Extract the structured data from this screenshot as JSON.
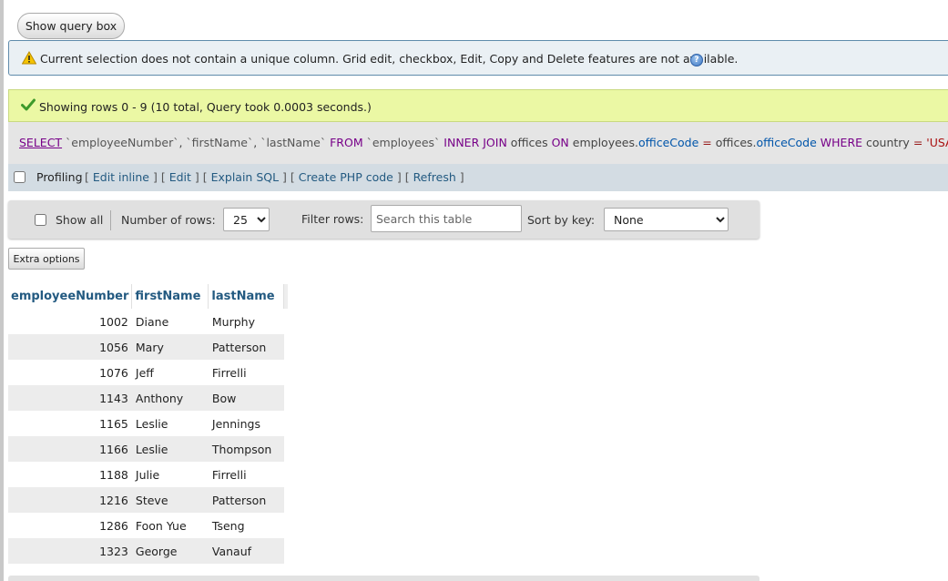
{
  "query_box": {
    "show_label": "Show query box"
  },
  "notice": {
    "text": "Current selection does not contain a unique column. Grid edit, checkbox, Edit, Copy and Delete features are not available.",
    "help_icon": "help-icon"
  },
  "success": {
    "text": "Showing rows 0 - 9 (10 total, Query took 0.0003 seconds.)"
  },
  "sql": {
    "select": "SELECT",
    "col1": "`employeeNumber`",
    "col2": "`firstName`",
    "col3": "`lastName`",
    "from": "FROM",
    "table": "`employees`",
    "join": "INNER JOIN",
    "join_table": "offices",
    "on": "ON",
    "left_tbl": "employees.",
    "left_col": "officeCode",
    "eq": "=",
    "right_tbl": "offices.",
    "right_col": "officeCode",
    "where": "WHERE",
    "where_col": "country",
    "where_val": "'USA'",
    "end": ";"
  },
  "profiling": {
    "label": "Profiling",
    "links": [
      "Edit inline",
      "Edit",
      "Explain SQL",
      "Create PHP code",
      "Refresh"
    ]
  },
  "navigation": {
    "show_all_label": "Show all",
    "rows_label": "Number of rows:",
    "rows_value": "25",
    "filter_label": "Filter rows:",
    "filter_placeholder": "Search this table",
    "sort_label": "Sort by key:",
    "sort_value": "None"
  },
  "extra_options_label": "Extra options",
  "table": {
    "headers": [
      "employeeNumber",
      "firstName",
      "lastName"
    ],
    "rows": [
      [
        "1002",
        "Diane",
        "Murphy"
      ],
      [
        "1056",
        "Mary",
        "Patterson"
      ],
      [
        "1076",
        "Jeff",
        "Firrelli"
      ],
      [
        "1143",
        "Anthony",
        "Bow"
      ],
      [
        "1165",
        "Leslie",
        "Jennings"
      ],
      [
        "1166",
        "Leslie",
        "Thompson"
      ],
      [
        "1188",
        "Julie",
        "Firrelli"
      ],
      [
        "1216",
        "Steve",
        "Patterson"
      ],
      [
        "1286",
        "Foon Yue",
        "Tseng"
      ],
      [
        "1323",
        "George",
        "Vanauf"
      ]
    ]
  },
  "colors": {
    "success_bg": "#ebf8a4",
    "notice_bg": "#eaf0f4",
    "link": "#235a81",
    "sql_keyword": "#770088"
  }
}
